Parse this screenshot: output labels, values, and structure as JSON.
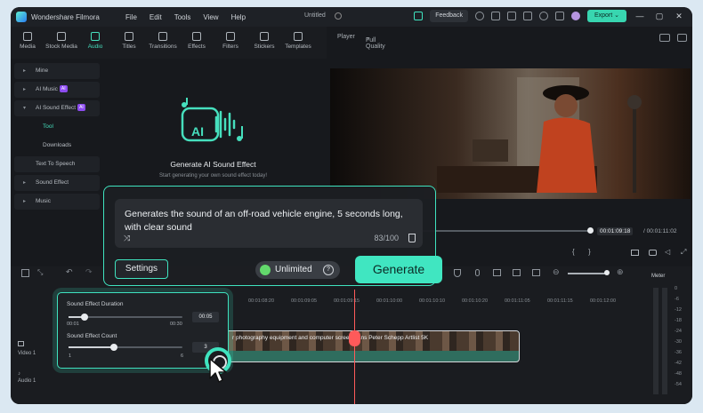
{
  "app": {
    "name": "Wondershare Filmora",
    "doc_title": "Untitled",
    "menus": [
      "File",
      "Edit",
      "Tools",
      "View",
      "Help"
    ],
    "feedback_label": "Feedback",
    "export_label": "Export"
  },
  "toolbar": {
    "tabs": [
      {
        "label": "Media",
        "icon": "media-icon"
      },
      {
        "label": "Stock Media",
        "icon": "stock-media-icon"
      },
      {
        "label": "Audio",
        "icon": "music-note-icon",
        "active": true
      },
      {
        "label": "Titles",
        "icon": "titles-icon"
      },
      {
        "label": "Transitions",
        "icon": "transitions-icon"
      },
      {
        "label": "Effects",
        "icon": "effects-icon"
      },
      {
        "label": "Filters",
        "icon": "filters-icon"
      },
      {
        "label": "Stickers",
        "icon": "stickers-icon"
      },
      {
        "label": "Templates",
        "icon": "templates-icon"
      }
    ]
  },
  "sidebar": {
    "items": [
      {
        "label": "Mine"
      },
      {
        "label": "AI Music",
        "badge": "AI"
      },
      {
        "label": "AI Sound Effect",
        "badge": "AI"
      },
      {
        "label": "Tool"
      },
      {
        "label": "Downloads"
      },
      {
        "label": "Text To Speech"
      },
      {
        "label": "Sound Effect"
      },
      {
        "label": "Music"
      }
    ]
  },
  "audio_panel": {
    "title": "Generate AI Sound Effect",
    "subtitle": "Start generating your own sound effect today!",
    "graphic_text": "AI"
  },
  "player": {
    "label": "Player",
    "quality": "Full Quality",
    "current_time": "00:01:09:18",
    "total_time": "/ 00:01:11:02"
  },
  "generate_popup": {
    "prompt": "Generates the sound of an off-road vehicle engine, 5 seconds long, with clear sound",
    "counter": "83/100",
    "settings_label": "Settings",
    "unlimited_label": "Unlimited",
    "generate_label": "Generate"
  },
  "settings_popup": {
    "duration_label": "Sound Effect Duration",
    "duration_min": "00:01",
    "duration_max": "00:30",
    "duration_value": "00:05",
    "duration_fraction": 0.14,
    "count_label": "Sound Effect Count",
    "count_min": "1",
    "count_max": "6",
    "count_value": "3",
    "count_fraction": 0.4
  },
  "timeline": {
    "ruler": [
      "00:01:08:20",
      "00:01:09:05",
      "00:01:09:15",
      "00:01:10:00",
      "00:01:10:10",
      "00:01:10:20",
      "00:01:11:05",
      "00:01:11:15",
      "00:01:12:00"
    ],
    "clip_label": "r photography equipment and computer screen · ans  Peter Schepp Artlist 5K",
    "video_track_label": "Video 1",
    "audio_track_label": "Audio 1",
    "meter_label": "Meter",
    "meter_scale": [
      "0",
      "-6",
      "-12",
      "-18",
      "-24",
      "-30",
      "-36",
      "-42",
      "-48",
      "-54"
    ]
  },
  "colors": {
    "accent": "#40e6c1",
    "ai_badge": "#8d4cf0",
    "playhead": "#ff5a5a"
  }
}
